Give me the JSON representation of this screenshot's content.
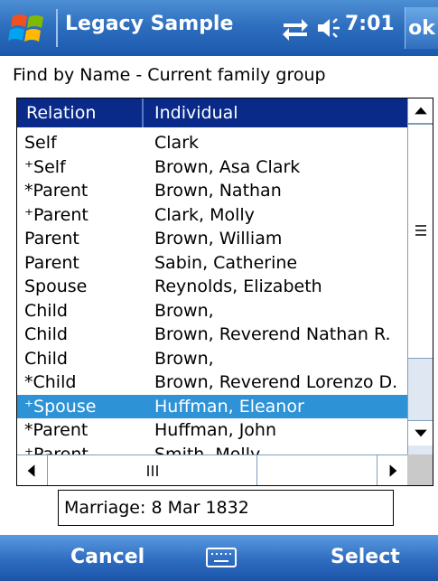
{
  "titlebar": {
    "app_title": "Legacy Sample",
    "time": "7:01",
    "ok_label": "ok"
  },
  "find_label": "Find by Name - Current family group",
  "list": {
    "columns": [
      "Relation",
      "Individual"
    ],
    "rows": [
      {
        "relation": "Self",
        "individual": "Clark"
      },
      {
        "relation": "⁺Self",
        "individual": "Brown, Asa Clark"
      },
      {
        "relation": "*Parent",
        "individual": "Brown, Nathan"
      },
      {
        "relation": "⁺Parent",
        "individual": "Clark, Molly"
      },
      {
        "relation": "Parent",
        "individual": "Brown, William"
      },
      {
        "relation": "Parent",
        "individual": "Sabin, Catherine"
      },
      {
        "relation": "Spouse",
        "individual": "Reynolds, Elizabeth"
      },
      {
        "relation": "Child",
        "individual": "Brown,"
      },
      {
        "relation": "Child",
        "individual": "Brown, Reverend Nathan R."
      },
      {
        "relation": "Child",
        "individual": "Brown,"
      },
      {
        "relation": "*Child",
        "individual": "Brown, Reverend Lorenzo D."
      },
      {
        "relation": "⁺Spouse",
        "individual": "Huffman, Eleanor"
      },
      {
        "relation": "*Parent",
        "individual": "Huffman, John"
      },
      {
        "relation": "⁺Parent",
        "individual": "Smith, Molly"
      }
    ],
    "selected_index": 11
  },
  "info_text": "Marriage: 8 Mar 1832",
  "menubar": {
    "left_label": "Cancel",
    "right_label": "Select"
  },
  "colors": {
    "titlebar": "#2f6fbf",
    "header": "#0a2a8a",
    "selection": "#2e92d6"
  }
}
